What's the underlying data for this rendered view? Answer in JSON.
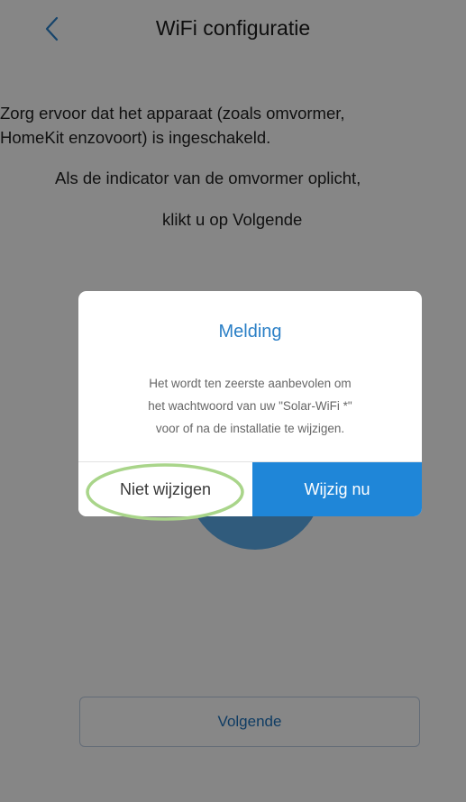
{
  "header": {
    "title": "WiFi configuratie",
    "back_icon": "chevron-left-icon"
  },
  "instructions": {
    "line1": "Zorg ervoor dat het apparaat (zoals omvormer,",
    "line2": "HomeKit enzovoort) is ingeschakeld.",
    "line3": "Als de indicator van de omvormer oplicht,",
    "line4": "klikt u op Volgende"
  },
  "next_button": {
    "label": "Volgende"
  },
  "dialog": {
    "title": "Melding",
    "message_line1": "Het wordt ten zeerste aanbevolen om",
    "message_line2": "het wachtwoord van uw \"Solar-WiFi *\"",
    "message_line3": "voor of na de installatie te wijzigen.",
    "cancel_label": "Niet wijzigen",
    "confirm_label": "Wijzig nu"
  },
  "colors": {
    "accent": "#2a7fc6",
    "confirm_button": "#1f86d8",
    "highlight_ring": "#a9d58a"
  }
}
